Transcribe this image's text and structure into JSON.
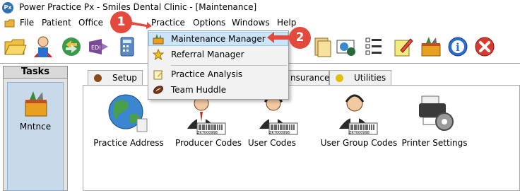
{
  "window": {
    "title": "Power Practice Px - Smiles Dental Clinic - [Maintenance]",
    "app_icon": "Px"
  },
  "menubar": {
    "items": [
      {
        "name": "file",
        "label": "File"
      },
      {
        "name": "patient",
        "label": "Patient"
      },
      {
        "name": "office",
        "label": "Office"
      },
      {
        "name": "practice",
        "label": "Practice"
      },
      {
        "name": "options",
        "label": "Options"
      },
      {
        "name": "windows",
        "label": "Windows"
      },
      {
        "name": "help",
        "label": "Help"
      }
    ]
  },
  "practice_menu": {
    "items": [
      {
        "label": "Maintenance Manager",
        "icon": "toolbox-icon"
      },
      {
        "label": "Referral Manager",
        "icon": "star-icon"
      },
      {
        "label": "Practice Analysis",
        "icon": "notepad-icon"
      },
      {
        "label": "Team Huddle",
        "icon": "football-icon"
      }
    ]
  },
  "tasks": {
    "header": "Tasks",
    "selected_label": "Mntnce"
  },
  "tabs": [
    {
      "label": "Setup",
      "color": "#8b4a1c"
    },
    {
      "label": "nsurance",
      "color": "#3a8a3a"
    },
    {
      "label": "Utilities",
      "color": "#e0c000"
    }
  ],
  "content_items": [
    {
      "label": "Practice Address",
      "icon": "globe-icon"
    },
    {
      "label": "Producer Codes",
      "icon": "user-barcode-icon",
      "barcode": "ZK7000998"
    },
    {
      "label": "User Codes",
      "icon": "headset-user-icon",
      "barcode": "ZK7000998"
    },
    {
      "label": "User Group Codes",
      "icon": "user-group-icon",
      "barcode": "ZK7000998"
    },
    {
      "label": "Printer Settings",
      "icon": "printer-gear-icon"
    }
  ],
  "callouts": [
    {
      "label": "1"
    },
    {
      "label": "2"
    }
  ],
  "colors": {
    "highlight": "#cce4f7",
    "callout": "#e3493c"
  }
}
